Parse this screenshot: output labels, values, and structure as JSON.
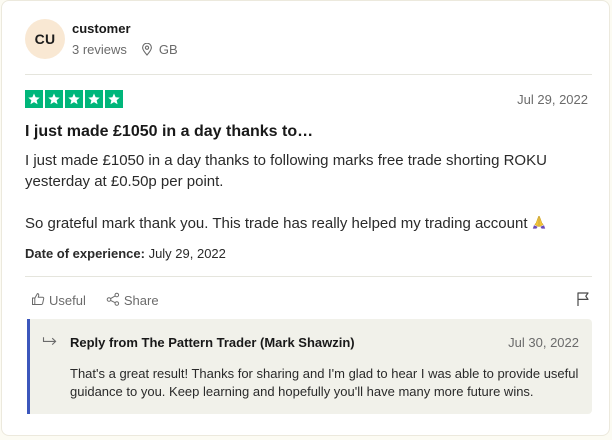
{
  "reviewer": {
    "initials": "CU",
    "name": "customer",
    "review_count": "3 reviews",
    "country": "GB"
  },
  "review": {
    "rating": 5,
    "date": "Jul 29, 2022",
    "title": "I just made £1050 in a day thanks to…",
    "body_paragraph_1": "I just made £1050 in a day thanks to following marks free trade shorting ROKU yesterday at £0.50p per point.",
    "body_paragraph_2": "So grateful mark thank you. This trade has really helped my trading account",
    "experience_label": "Date of experience:",
    "experience_date": "July 29, 2022"
  },
  "actions": {
    "useful_label": "Useful",
    "share_label": "Share"
  },
  "reply": {
    "from": "Reply from The Pattern Trader (Mark Shawzin)",
    "date": "Jul 30, 2022",
    "text": "That's a great result! Thanks for sharing and I'm glad to hear I was able to provide useful guidance to you. Keep learning and hopefully you'll have many more future wins."
  },
  "colors": {
    "star_green": "#00b67a",
    "reply_accent": "#3c57bc",
    "avatar_bg": "#f9e8d3"
  },
  "icons": [
    "location-pin-icon",
    "star-icon",
    "praying-hands-emoji",
    "thumbs-up-icon",
    "share-icon",
    "flag-icon",
    "reply-arrow-icon"
  ]
}
